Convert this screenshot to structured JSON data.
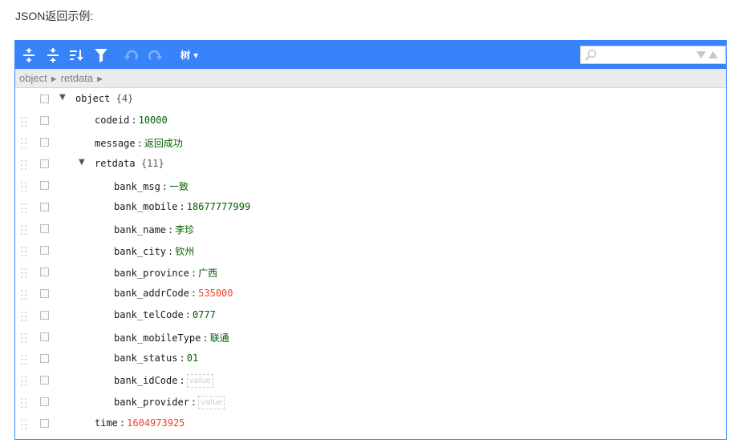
{
  "page": {
    "heading": "JSON返回示例:"
  },
  "toolbar": {
    "mode_label": "树",
    "buttons": [
      {
        "name": "expand-all-icon"
      },
      {
        "name": "collapse-all-icon"
      },
      {
        "name": "sort-icon"
      },
      {
        "name": "filter-icon"
      },
      {
        "name": "undo-icon"
      },
      {
        "name": "redo-icon"
      }
    ],
    "search": {
      "placeholder": "",
      "value": ""
    },
    "accent_color": "#3883fa"
  },
  "breadcrumb": {
    "items": [
      "object",
      "retdata"
    ]
  },
  "tree": {
    "root": {
      "field": "object",
      "count": "{4}"
    },
    "codeid": {
      "field": "codeid",
      "value": "10000"
    },
    "message": {
      "field": "message",
      "value": "返回成功"
    },
    "retdata": {
      "field": "retdata",
      "count": "{11}"
    },
    "bank_msg": {
      "field": "bank_msg",
      "value": "一致"
    },
    "bank_mobile": {
      "field": "bank_mobile",
      "value": "18677777999"
    },
    "bank_name": {
      "field": "bank_name",
      "value": "李珍"
    },
    "bank_city": {
      "field": "bank_city",
      "value": "钦州"
    },
    "bank_province": {
      "field": "bank_province",
      "value": "广西"
    },
    "bank_addrCode": {
      "field": "bank_addrCode",
      "value": "535000"
    },
    "bank_telCode": {
      "field": "bank_telCode",
      "value": "0777"
    },
    "bank_mobileType": {
      "field": "bank_mobileType",
      "value": "联通"
    },
    "bank_status": {
      "field": "bank_status",
      "value": "01"
    },
    "bank_idCode": {
      "field": "bank_idCode",
      "value": "",
      "placeholder": "value"
    },
    "bank_provider": {
      "field": "bank_provider",
      "value": "",
      "placeholder": "value"
    },
    "time": {
      "field": "time",
      "value": "1604973925"
    }
  },
  "colors": {
    "string_value": "#006000",
    "number_value": "#ee422e"
  },
  "separator": ":"
}
